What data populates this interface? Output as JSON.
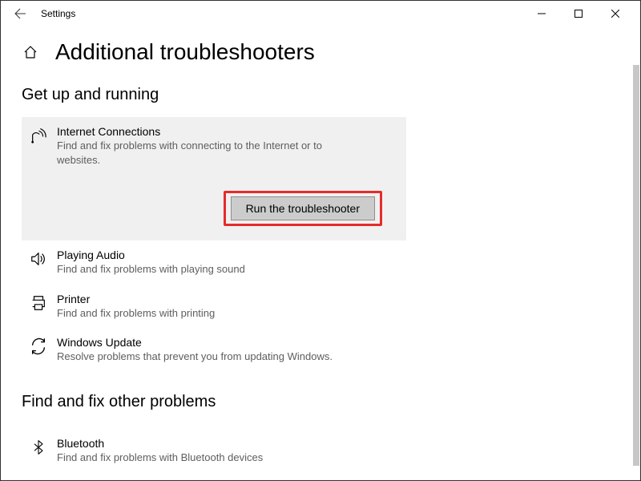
{
  "window": {
    "title": "Settings"
  },
  "page": {
    "title": "Additional troubleshooters"
  },
  "section1": {
    "title": "Get up and running",
    "items": [
      {
        "name": "Internet Connections",
        "desc": "Find and fix problems with connecting to the Internet or to websites."
      },
      {
        "name": "Playing Audio",
        "desc": "Find and fix problems with playing sound"
      },
      {
        "name": "Printer",
        "desc": "Find and fix problems with printing"
      },
      {
        "name": "Windows Update",
        "desc": "Resolve problems that prevent you from updating Windows."
      }
    ]
  },
  "section2": {
    "title": "Find and fix other problems",
    "items": [
      {
        "name": "Bluetooth",
        "desc": "Find and fix problems with Bluetooth devices"
      }
    ]
  },
  "run_button": "Run the troubleshooter"
}
